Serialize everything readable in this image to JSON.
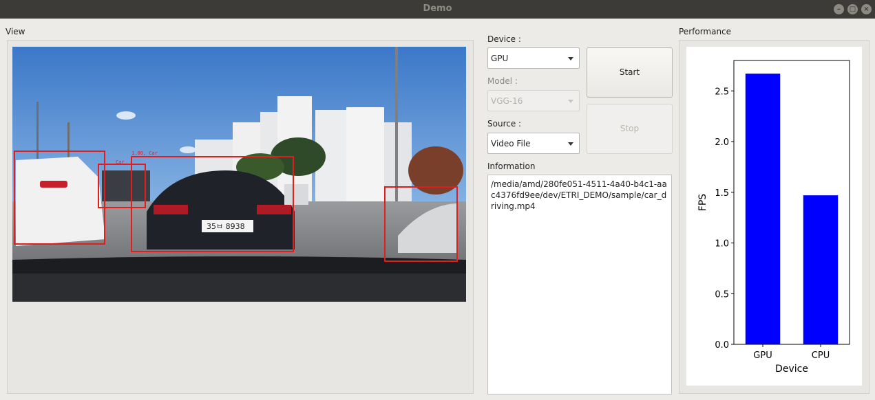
{
  "window": {
    "title": "Demo"
  },
  "view": {
    "label": "View",
    "detections": [
      {
        "label": "",
        "name": "car-left"
      },
      {
        "label": "Car",
        "name": "car-small"
      },
      {
        "label": "1.00, Car",
        "name": "car-center"
      },
      {
        "label": "",
        "name": "car-right"
      }
    ],
    "plate_text": "35ㅂ 8938"
  },
  "controls": {
    "device_label": "Device :",
    "device_value": "GPU",
    "model_label": "Model :",
    "model_value": "VGG-16",
    "source_label": "Source :",
    "source_value": "Video File",
    "start_label": "Start",
    "stop_label": "Stop",
    "information_label": "Information",
    "information_text": "/media/amd/280fe051-4511-4a40-b4c1-aac4376fd9ee/dev/ETRI_DEMO/sample/car_driving.mp4"
  },
  "performance": {
    "label": "Performance"
  },
  "chart_data": {
    "type": "bar",
    "categories": [
      "GPU",
      "CPU"
    ],
    "values": [
      2.67,
      1.47
    ],
    "xlabel": "Device",
    "ylabel": "FPS",
    "ylim": [
      0,
      2.8
    ],
    "yticks": [
      "0.0",
      "0.5",
      "1.0",
      "1.5",
      "2.0",
      "2.5"
    ],
    "bar_color": "#0000ff",
    "grid": false
  }
}
